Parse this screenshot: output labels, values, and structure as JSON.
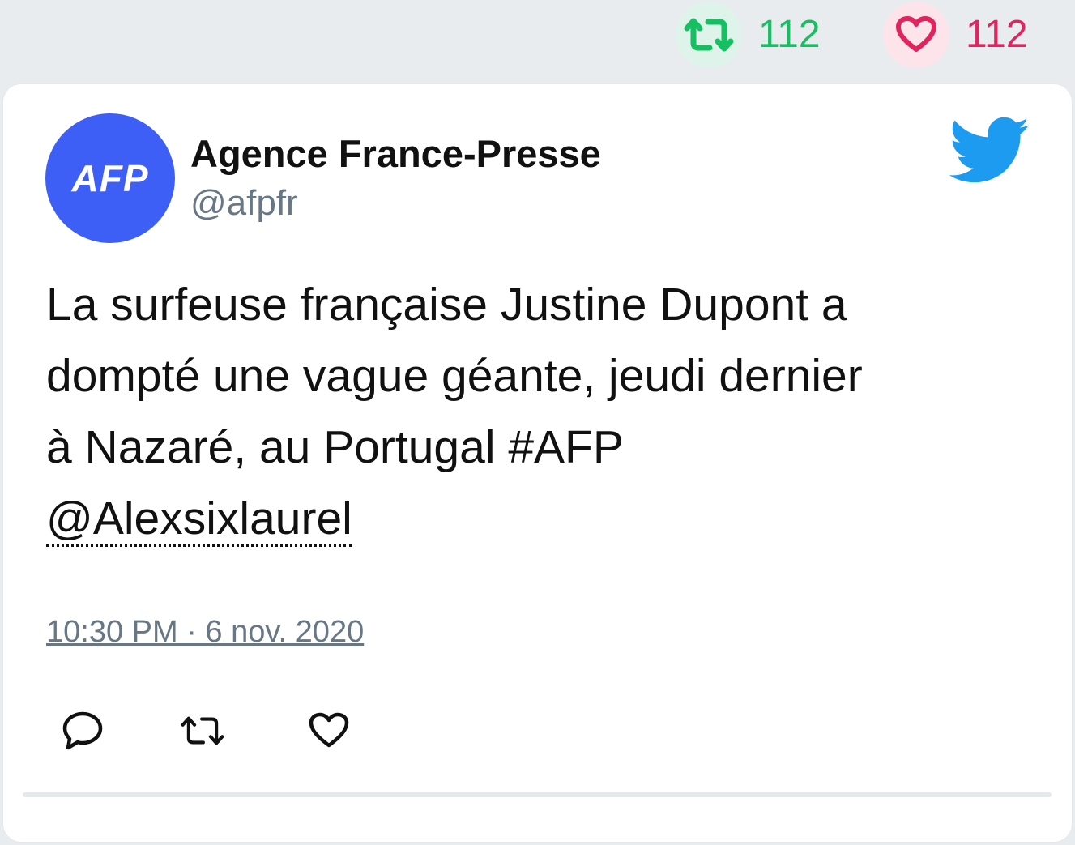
{
  "stats": {
    "retweets": "112",
    "likes": "112"
  },
  "tweet": {
    "author_name": "Agence France-Presse",
    "author_handle": "@afpfr",
    "avatar_text": "AFP",
    "text_lines": [
      "La surfeuse française Justine Dupont a",
      "dompté une vague géante, jeudi dernier",
      "à Nazaré, au Portugal #AFP"
    ],
    "mention": "@Alexsixlaurel",
    "timestamp": "10:30 PM · 6 nov. 2020"
  },
  "icons": {
    "stat_retweet": "retweet-icon",
    "stat_like": "heart-icon",
    "brand": "twitter-bird-icon",
    "reply": "reply-icon",
    "retweet": "retweet-icon",
    "like": "heart-icon"
  },
  "colors": {
    "retweet_green": "#17bf63",
    "like_pink": "#e0245e",
    "twitter_blue": "#1d9bf0",
    "avatar_blue": "#3d5ff6",
    "muted_text": "#687785"
  }
}
